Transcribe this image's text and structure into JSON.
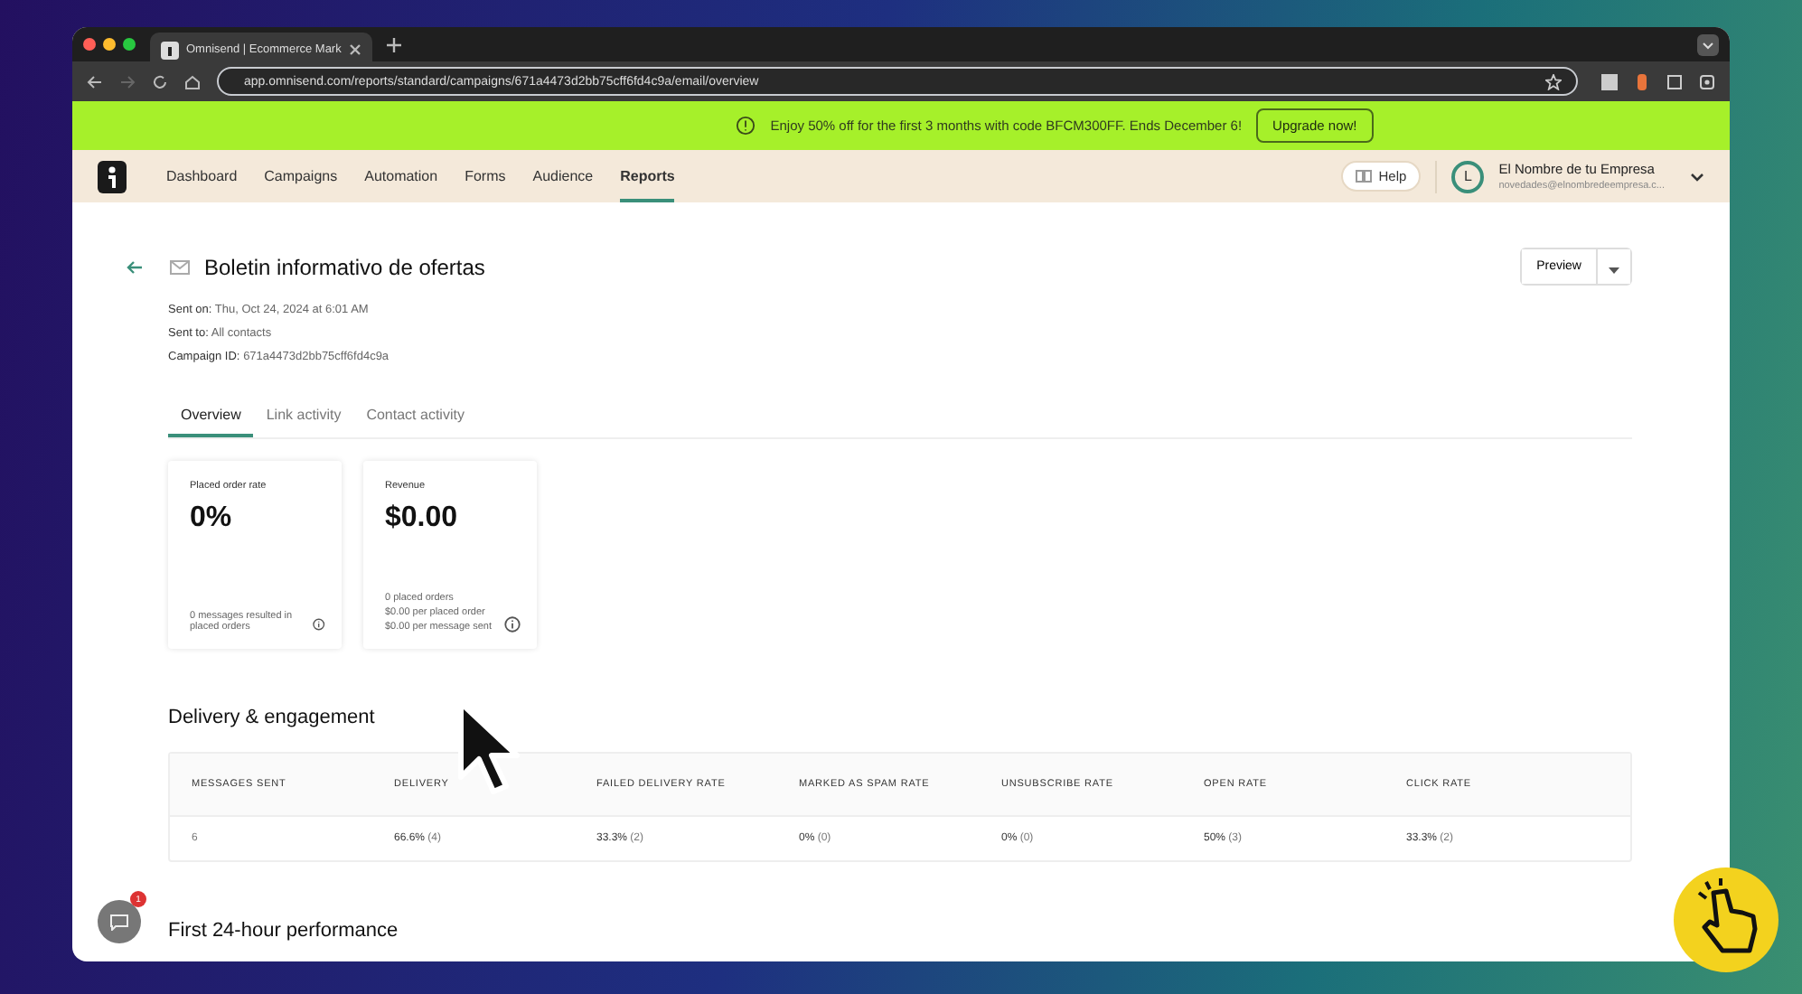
{
  "browser": {
    "tab_title": "Omnisend | Ecommerce Mark",
    "url": "app.omnisend.com/reports/standard/campaigns/671a4473d2bb75cff6fd4c9a/email/overview"
  },
  "banner": {
    "text": "Enjoy 50% off for the first 3 months with code BFCM300FF. Ends December 6!",
    "button": "Upgrade now!"
  },
  "nav": {
    "items": [
      {
        "label": "Dashboard",
        "selected": false
      },
      {
        "label": "Campaigns",
        "selected": false
      },
      {
        "label": "Automation",
        "selected": false
      },
      {
        "label": "Forms",
        "selected": false
      },
      {
        "label": "Audience",
        "selected": false
      },
      {
        "label": "Reports",
        "selected": true
      }
    ],
    "help": "Help",
    "account": {
      "initial": "L",
      "name": "El Nombre de tu Empresa",
      "email": "novedades@elnombredeempresa.c..."
    }
  },
  "campaign": {
    "title": "Boletin informativo de ofertas",
    "preview_button": "Preview",
    "meta": [
      {
        "label": "Sent on:",
        "value": "Thu, Oct 24, 2024 at 6:01 AM"
      },
      {
        "label": "Sent to:",
        "value": "All contacts"
      },
      {
        "label": "Campaign ID:",
        "value": "671a4473d2bb75cff6fd4c9a"
      }
    ],
    "tabs": [
      {
        "label": "Overview",
        "selected": true
      },
      {
        "label": "Link activity",
        "selected": false
      },
      {
        "label": "Contact activity",
        "selected": false
      }
    ]
  },
  "cards": [
    {
      "title": "Placed order rate",
      "value": "0%",
      "notes": [
        "0 messages resulted in placed orders"
      ]
    },
    {
      "title": "Revenue",
      "value": "$0.00",
      "notes": [
        "0 placed orders",
        "$0.00 per placed order",
        "$0.00 per message sent"
      ]
    }
  ],
  "delivery": {
    "heading": "Delivery & engagement",
    "columns": [
      "MESSAGES SENT",
      "DELIVERY",
      "FAILED DELIVERY RATE",
      "MARKED AS SPAM RATE",
      "UNSUBSCRIBE RATE",
      "OPEN RATE",
      "CLICK RATE"
    ],
    "rows": [
      [
        "6",
        "**66.6%** (4)",
        "**33.3%** (2)",
        "**0%** (0)",
        "**0%** (0)",
        "**50%** (3)",
        "**33.3%** (2)"
      ]
    ]
  },
  "performance": {
    "heading": "First 24-hour performance"
  },
  "chat": {
    "badge": "1"
  }
}
